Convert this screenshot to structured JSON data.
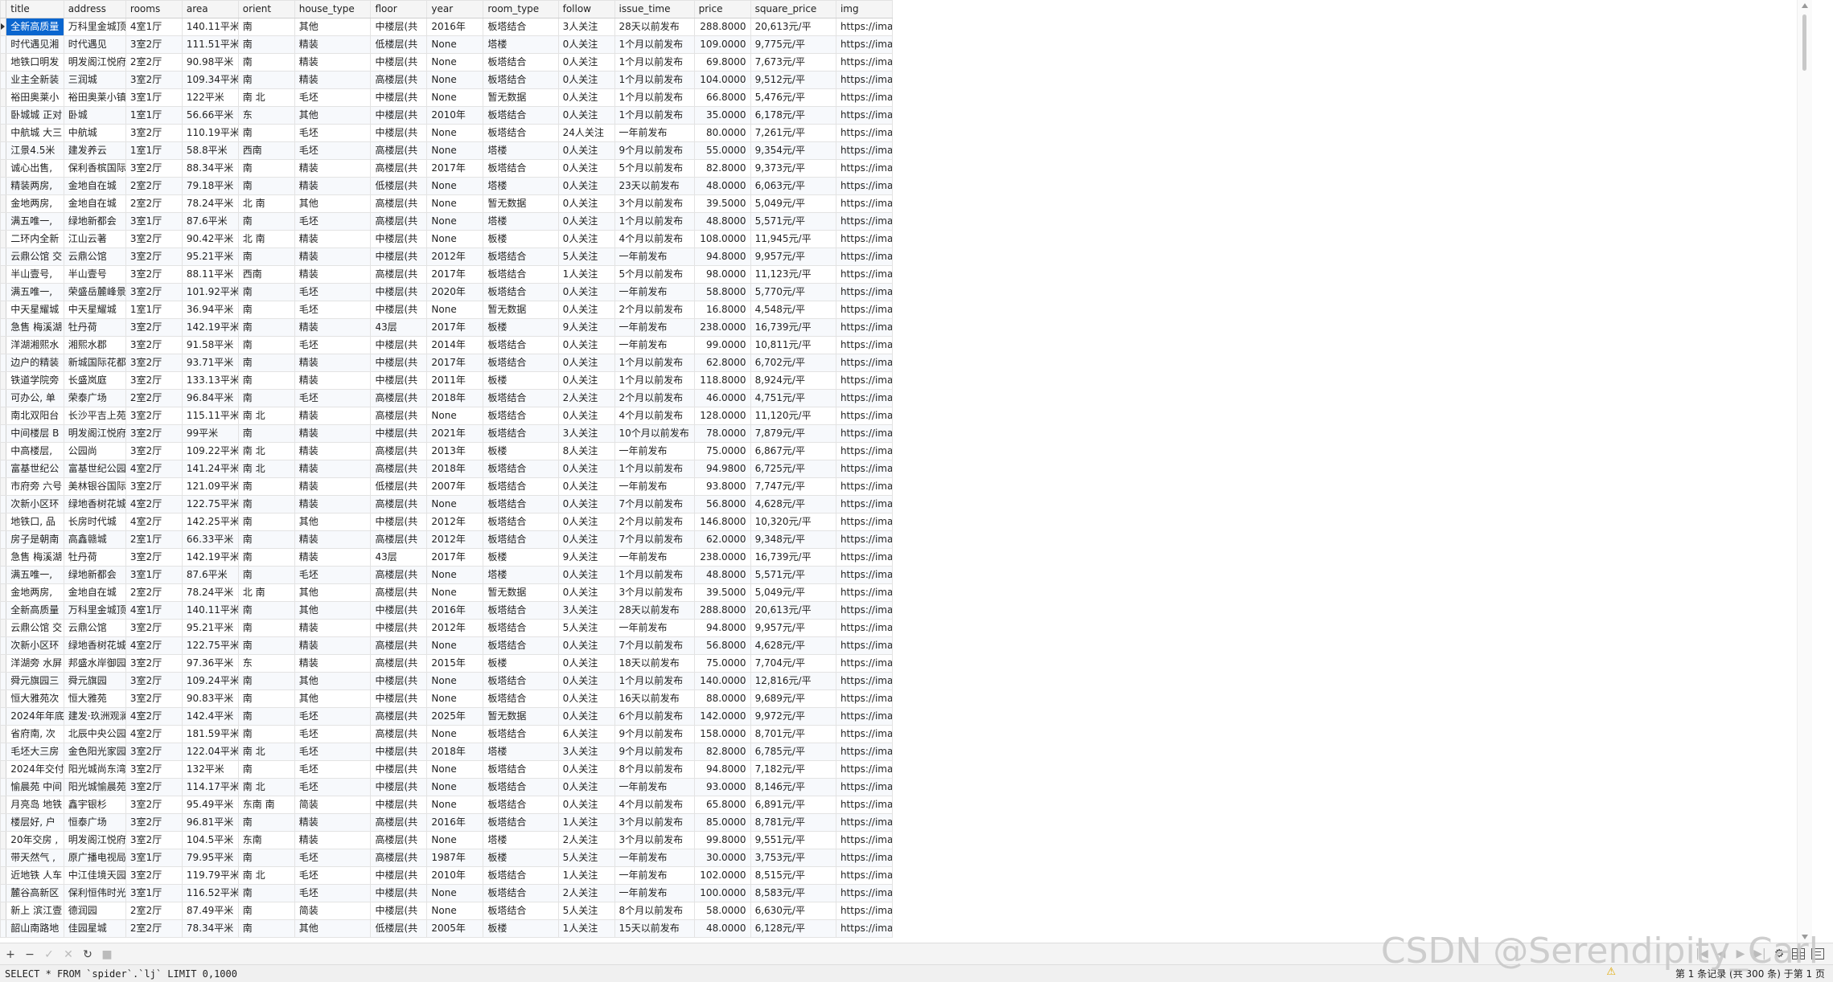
{
  "columns": [
    "title",
    "address",
    "rooms",
    "area",
    "orient",
    "house_type",
    "floor",
    "year",
    "room_type",
    "follow",
    "issue_time",
    "price",
    "square_price",
    "img"
  ],
  "rows": [
    [
      "全新高质量",
      "万科里金城顶",
      "4室1厅",
      "140.11平米",
      "南",
      "其他",
      "中楼层(共",
      "2016年",
      "板塔结合",
      "3人关注",
      "28天以前发布",
      "288.8000",
      "20,613元/平",
      "https://ima"
    ],
    [
      "时代遇见湘",
      "时代遇见",
      "3室2厅",
      "111.51平米",
      "南",
      "精装",
      "低楼层(共",
      "None",
      "塔楼",
      "0人关注",
      "1个月以前发布",
      "109.0000",
      "9,775元/平",
      "https://ima"
    ],
    [
      "地铁口明发",
      "明发阁江悦府",
      "2室2厅",
      "90.98平米",
      "南",
      "精装",
      "中楼层(共",
      "None",
      "板塔结合",
      "0人关注",
      "1个月以前发布",
      "69.8000",
      "7,673元/平",
      "https://ima"
    ],
    [
      "业主全新装",
      "三润城",
      "3室2厅",
      "109.34平米",
      "南",
      "精装",
      "高楼层(共",
      "None",
      "板塔结合",
      "0人关注",
      "1个月以前发布",
      "104.0000",
      "9,512元/平",
      "https://ima"
    ],
    [
      "裕田奥莱小",
      "裕田奥莱小镇",
      "3室1厅",
      "122平米",
      "南 北",
      "毛坯",
      "中楼层(共",
      "None",
      "暂无数据",
      "0人关注",
      "1个月以前发布",
      "66.8000",
      "5,476元/平",
      "https://ima"
    ],
    [
      "卧城城 正对",
      "卧城",
      "1室1厅",
      "56.66平米",
      "东",
      "其他",
      "中楼层(共",
      "2010年",
      "板塔结合",
      "0人关注",
      "1个月以前发布",
      "35.0000",
      "6,178元/平",
      "https://ima"
    ],
    [
      "中航城 大三",
      "中航城",
      "3室2厅",
      "110.19平米",
      "南",
      "毛坯",
      "中楼层(共",
      "None",
      "板塔结合",
      "24人关注",
      "一年前发布",
      "80.0000",
      "7,261元/平",
      "https://ima"
    ],
    [
      "江景4.5米",
      "建发养云",
      "1室1厅",
      "58.8平米",
      "西南",
      "毛坯",
      "高楼层(共",
      "None",
      "塔楼",
      "0人关注",
      "9个月以前发布",
      "55.0000",
      "9,354元/平",
      "https://ima"
    ],
    [
      "诚心出售,",
      "保利香槟国际",
      "3室2厅",
      "88.34平米",
      "南",
      "精装",
      "高楼层(共",
      "2017年",
      "板塔结合",
      "0人关注",
      "5个月以前发布",
      "82.8000",
      "9,373元/平",
      "https://ima"
    ],
    [
      "精装两房,",
      "金地自在城",
      "2室2厅",
      "79.18平米",
      "南",
      "精装",
      "低楼层(共",
      "None",
      "塔楼",
      "0人关注",
      "23天以前发布",
      "48.0000",
      "6,063元/平",
      "https://ima"
    ],
    [
      "金地两房,",
      "金地自在城",
      "2室2厅",
      "78.24平米",
      "北 南",
      "其他",
      "高楼层(共",
      "None",
      "暂无数据",
      "0人关注",
      "3个月以前发布",
      "39.5000",
      "5,049元/平",
      "https://ima"
    ],
    [
      "满五唯一,",
      "绿地新都会",
      "3室1厅",
      "87.6平米",
      "南",
      "毛坯",
      "高楼层(共",
      "None",
      "塔楼",
      "0人关注",
      "1个月以前发布",
      "48.8000",
      "5,571元/平",
      "https://ima"
    ],
    [
      "二环内全新",
      "江山云著",
      "3室2厅",
      "90.42平米",
      "北 南",
      "精装",
      "中楼层(共",
      "None",
      "板楼",
      "0人关注",
      "4个月以前发布",
      "108.0000",
      "11,945元/平",
      "https://ima"
    ],
    [
      "云鼎公馆 交",
      "云鼎公馆",
      "3室2厅",
      "95.21平米",
      "南",
      "精装",
      "中楼层(共",
      "2012年",
      "板塔结合",
      "5人关注",
      "一年前发布",
      "94.8000",
      "9,957元/平",
      "https://ima"
    ],
    [
      "半山壹号,",
      "半山壹号",
      "3室2厅",
      "88.11平米",
      "西南",
      "精装",
      "高楼层(共",
      "2017年",
      "板塔结合",
      "1人关注",
      "5个月以前发布",
      "98.0000",
      "11,123元/平",
      "https://ima"
    ],
    [
      "满五唯一,",
      "荣盛岳麓峰景",
      "3室2厅",
      "101.92平米",
      "南",
      "毛坯",
      "中楼层(共",
      "2020年",
      "板塔结合",
      "0人关注",
      "一年前发布",
      "58.8000",
      "5,770元/平",
      "https://ima"
    ],
    [
      "中天星耀城",
      "中天星耀城",
      "1室1厅",
      "36.94平米",
      "南",
      "毛坯",
      "中楼层(共",
      "None",
      "暂无数据",
      "0人关注",
      "2个月以前发布",
      "16.8000",
      "4,548元/平",
      "https://ima"
    ],
    [
      "急售 梅溪湖",
      "牡丹荷",
      "3室2厅",
      "142.19平米",
      "南",
      "精装",
      "43层",
      "2017年",
      "板楼",
      "9人关注",
      "一年前发布",
      "238.0000",
      "16,739元/平",
      "https://ima"
    ],
    [
      "洋湖湘熙水",
      "湘熙水郡",
      "3室2厅",
      "91.58平米",
      "南",
      "毛坯",
      "中楼层(共",
      "2014年",
      "板塔结合",
      "0人关注",
      "一年前发布",
      "99.0000",
      "10,811元/平",
      "https://ima"
    ],
    [
      "边户的精装",
      "新城国际花都",
      "3室2厅",
      "93.71平米",
      "南",
      "精装",
      "中楼层(共",
      "2017年",
      "板塔结合",
      "0人关注",
      "1个月以前发布",
      "62.8000",
      "6,702元/平",
      "https://ima"
    ],
    [
      "铁道学院旁",
      "长盛岚庭",
      "3室2厅",
      "133.13平米",
      "南",
      "精装",
      "中楼层(共",
      "2011年",
      "板楼",
      "0人关注",
      "1个月以前发布",
      "118.8000",
      "8,924元/平",
      "https://ima"
    ],
    [
      "可办公, 单",
      "荣泰广场",
      "2室2厅",
      "96.84平米",
      "南",
      "毛坯",
      "高楼层(共",
      "2018年",
      "板塔结合",
      "2人关注",
      "2个月以前发布",
      "46.0000",
      "4,751元/平",
      "https://ima"
    ],
    [
      "南北双阳台",
      "长沙平吉上苑",
      "3室2厅",
      "115.11平米",
      "南 北",
      "精装",
      "高楼层(共",
      "None",
      "板塔结合",
      "0人关注",
      "4个月以前发布",
      "128.0000",
      "11,120元/平",
      "https://ima"
    ],
    [
      "中间楼层 B",
      "明发阁江悦府",
      "3室2厅",
      "99平米",
      "南",
      "精装",
      "中楼层(共",
      "2021年",
      "板塔结合",
      "3人关注",
      "10个月以前发布",
      "78.0000",
      "7,879元/平",
      "https://ima"
    ],
    [
      "中高楼层,",
      "公园尚",
      "3室2厅",
      "109.22平米",
      "南 北",
      "精装",
      "高楼层(共",
      "2013年",
      "板楼",
      "8人关注",
      "一年前发布",
      "75.0000",
      "6,867元/平",
      "https://ima"
    ],
    [
      "富基世纪公",
      "富基世纪公园",
      "4室2厅",
      "141.24平米",
      "南 北",
      "精装",
      "高楼层(共",
      "2018年",
      "板塔结合",
      "0人关注",
      "1个月以前发布",
      "94.9800",
      "6,725元/平",
      "https://ima"
    ],
    [
      "市府旁 六号",
      "美林银谷国际",
      "3室2厅",
      "121.09平米",
      "南",
      "精装",
      "低楼层(共",
      "2007年",
      "板塔结合",
      "0人关注",
      "一年前发布",
      "93.8000",
      "7,747元/平",
      "https://ima"
    ],
    [
      "次新小区环",
      "绿地香树花城",
      "4室2厅",
      "122.75平米",
      "南",
      "精装",
      "高楼层(共",
      "None",
      "板塔结合",
      "0人关注",
      "7个月以前发布",
      "56.8000",
      "4,628元/平",
      "https://ima"
    ],
    [
      "地铁口, 品",
      "长房时代城",
      "4室2厅",
      "142.25平米",
      "南",
      "其他",
      "中楼层(共",
      "2012年",
      "板塔结合",
      "0人关注",
      "2个月以前发布",
      "146.8000",
      "10,320元/平",
      "https://ima"
    ],
    [
      "房子是朝南",
      "高鑫赣城",
      "2室1厅",
      "66.33平米",
      "南",
      "精装",
      "高楼层(共",
      "2012年",
      "板塔结合",
      "0人关注",
      "7个月以前发布",
      "62.0000",
      "9,348元/平",
      "https://ima"
    ],
    [
      "急售 梅溪湖",
      "牡丹荷",
      "3室2厅",
      "142.19平米",
      "南",
      "精装",
      "43层",
      "2017年",
      "板楼",
      "9人关注",
      "一年前发布",
      "238.0000",
      "16,739元/平",
      "https://ima"
    ],
    [
      "满五唯一,",
      "绿地新都会",
      "3室1厅",
      "87.6平米",
      "南",
      "毛坯",
      "高楼层(共",
      "None",
      "塔楼",
      "0人关注",
      "1个月以前发布",
      "48.8000",
      "5,571元/平",
      "https://ima"
    ],
    [
      "金地两房,",
      "金地自在城",
      "2室2厅",
      "78.24平米",
      "北 南",
      "其他",
      "高楼层(共",
      "None",
      "暂无数据",
      "0人关注",
      "3个月以前发布",
      "39.5000",
      "5,049元/平",
      "https://ima"
    ],
    [
      "全新高质量",
      "万科里金城顶",
      "4室1厅",
      "140.11平米",
      "南",
      "其他",
      "中楼层(共",
      "2016年",
      "板塔结合",
      "3人关注",
      "28天以前发布",
      "288.8000",
      "20,613元/平",
      "https://ima"
    ],
    [
      "云鼎公馆 交",
      "云鼎公馆",
      "3室2厅",
      "95.21平米",
      "南",
      "精装",
      "中楼层(共",
      "2012年",
      "板塔结合",
      "5人关注",
      "一年前发布",
      "94.8000",
      "9,957元/平",
      "https://ima"
    ],
    [
      "次新小区环",
      "绿地香树花城",
      "4室2厅",
      "122.75平米",
      "南",
      "精装",
      "高楼层(共",
      "None",
      "板塔结合",
      "0人关注",
      "7个月以前发布",
      "56.8000",
      "4,628元/平",
      "https://ima"
    ],
    [
      "洋湖旁 水屏",
      "邦盛水岸御园",
      "3室2厅",
      "97.36平米",
      "东",
      "精装",
      "高楼层(共",
      "2015年",
      "板楼",
      "0人关注",
      "18天以前发布",
      "75.0000",
      "7,704元/平",
      "https://ima"
    ],
    [
      "舜元旗园三",
      "舜元旗园",
      "3室2厅",
      "109.24平米",
      "南",
      "其他",
      "中楼层(共",
      "None",
      "板塔结合",
      "0人关注",
      "1个月以前发布",
      "140.0000",
      "12,816元/平",
      "https://ima"
    ],
    [
      "恒大雅苑次",
      "恒大雅苑",
      "3室2厅",
      "90.83平米",
      "南",
      "其他",
      "中楼层(共",
      "None",
      "板塔结合",
      "0人关注",
      "16天以前发布",
      "88.0000",
      "9,689元/平",
      "https://ima"
    ],
    [
      "2024年年底",
      "建发·玖洲观澜",
      "4室2厅",
      "142.4平米",
      "南",
      "毛坯",
      "高楼层(共",
      "2025年",
      "暂无数据",
      "0人关注",
      "6个月以前发布",
      "142.0000",
      "9,972元/平",
      "https://ima"
    ],
    [
      "省府南, 次",
      "北辰中央公园",
      "4室2厅",
      "181.59平米",
      "南",
      "毛坯",
      "高楼层(共",
      "None",
      "板塔结合",
      "6人关注",
      "9个月以前发布",
      "158.0000",
      "8,701元/平",
      "https://ima"
    ],
    [
      "毛坯大三房",
      "金色阳光家园",
      "3室2厅",
      "122.04平米",
      "南 北",
      "毛坯",
      "中楼层(共",
      "2018年",
      "塔楼",
      "3人关注",
      "9个月以前发布",
      "82.8000",
      "6,785元/平",
      "https://ima"
    ],
    [
      "2024年交付",
      "阳光城尚东湾",
      "3室2厅",
      "132平米",
      "南",
      "毛坯",
      "中楼层(共",
      "None",
      "板塔结合",
      "0人关注",
      "8个月以前发布",
      "94.8000",
      "7,182元/平",
      "https://ima"
    ],
    [
      "愉晨苑 中间",
      "阳光城愉晨苑",
      "3室2厅",
      "114.17平米",
      "南 北",
      "毛坯",
      "中楼层(共",
      "None",
      "板塔结合",
      "0人关注",
      "一年前发布",
      "93.0000",
      "8,146元/平",
      "https://ima"
    ],
    [
      "月亮岛 地铁",
      "鑫宇银杉",
      "3室2厅",
      "95.49平米",
      "东南 南",
      "简装",
      "中楼层(共",
      "None",
      "板塔结合",
      "0人关注",
      "4个月以前发布",
      "65.8000",
      "6,891元/平",
      "https://ima"
    ],
    [
      "楼层好, 户",
      "恒泰广场",
      "3室2厅",
      "96.81平米",
      "南",
      "精装",
      "高楼层(共",
      "2016年",
      "板塔结合",
      "1人关注",
      "3个月以前发布",
      "85.0000",
      "8,781元/平",
      "https://ima"
    ],
    [
      "20年交房 ,",
      "明发阁江悦府",
      "3室2厅",
      "104.5平米",
      "东南",
      "精装",
      "高楼层(共",
      "None",
      "塔楼",
      "2人关注",
      "3个月以前发布",
      "99.8000",
      "9,551元/平",
      "https://ima"
    ],
    [
      "带天然气 ,",
      "原广播电视局",
      "3室1厅",
      "79.95平米",
      "南",
      "毛坯",
      "高楼层(共",
      "1987年",
      "板楼",
      "5人关注",
      "一年前发布",
      "30.0000",
      "3,753元/平",
      "https://ima"
    ],
    [
      "近地铁 人车",
      "中江佳境天园",
      "3室2厅",
      "119.79平米",
      "南 北",
      "毛坯",
      "中楼层(共",
      "2010年",
      "板塔结合",
      "1人关注",
      "一年前发布",
      "102.0000",
      "8,515元/平",
      "https://ima"
    ],
    [
      "麓谷高新区",
      "保利恒伟时光",
      "3室1厅",
      "116.52平米",
      "南",
      "毛坯",
      "中楼层(共",
      "None",
      "板塔结合",
      "2人关注",
      "一年前发布",
      "100.0000",
      "8,583元/平",
      "https://ima"
    ],
    [
      "新上 滨江壹",
      "德润园",
      "2室2厅",
      "87.49平米",
      "南",
      "简装",
      "中楼层(共",
      "None",
      "板塔结合",
      "5人关注",
      "8个月以前发布",
      "58.0000",
      "6,630元/平",
      "https://ima"
    ],
    [
      "韶山南路地",
      "佳园星城",
      "2室2厅",
      "78.34平米",
      "南",
      "其他",
      "低楼层(共",
      "2005年",
      "板楼",
      "1人关注",
      "15天以前发布",
      "48.0000",
      "6,128元/平",
      "https://ima"
    ]
  ],
  "toolbar": {
    "add": "+",
    "remove": "−",
    "apply": "✓",
    "discard": "✕",
    "refresh": "↻",
    "stop": "■",
    "first": "|◀",
    "prev": "◀",
    "next": "▶",
    "last": "▶|",
    "settings": "⚙"
  },
  "status": {
    "sql": "SELECT * FROM `spider`.`lj` LIMIT 0,1000",
    "warning_icon": "⚠",
    "record_info": "第 1 条记录 (共 300 条) 于第 1 页"
  },
  "watermark": "CSDN @Serendipity_Carl"
}
